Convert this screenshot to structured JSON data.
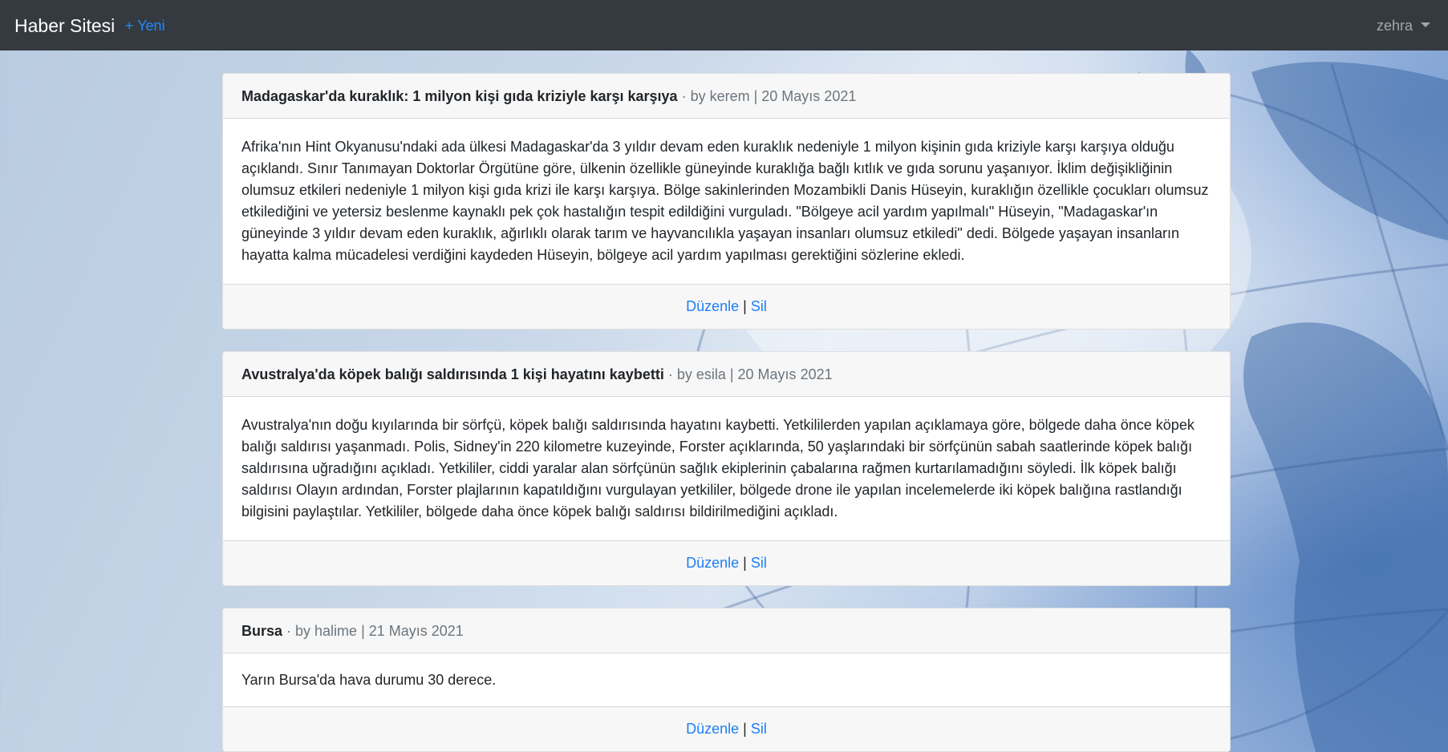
{
  "navbar": {
    "brand": "Haber Sitesi",
    "new_link": "+ Yeni",
    "user": "zehra"
  },
  "articles": [
    {
      "title": "Madagaskar'da kuraklık: 1 milyon kişi gıda kriziyle karşı karşıya",
      "meta": " · by kerem | 20 Mayıs 2021",
      "body": "Afrika'nın Hint Okyanusu'ndaki ada ülkesi Madagaskar'da 3 yıldır devam eden kuraklık nedeniyle 1 milyon kişinin gıda kriziyle karşı karşıya olduğu açıklandı. Sınır Tanımayan Doktorlar Örgütüne göre, ülkenin özellikle güneyinde kuraklığa bağlı kıtlık ve gıda sorunu yaşanıyor. İklim değişikliğinin olumsuz etkileri nedeniyle 1 milyon kişi gıda krizi ile karşı karşıya. Bölge sakinlerinden Mozambikli Danis Hüseyin, kuraklığın özellikle çocukları olumsuz etkilediğini ve yetersiz beslenme kaynaklı pek çok hastalığın tespit edildiğini vurguladı. \"Bölgeye acil yardım yapılmalı\" Hüseyin, \"Madagaskar'ın güneyinde 3 yıldır devam eden kuraklık, ağırlıklı olarak tarım ve hayvancılıkla yaşayan insanları olumsuz etkiledi\" dedi. Bölgede yaşayan insanların hayatta kalma mücadelesi verdiğini kaydeden Hüseyin, bölgeye acil yardım yapılması gerektiğini sözlerine ekledi.",
      "edit_label": "Düzenle",
      "separator": " | ",
      "delete_label": "Sil"
    },
    {
      "title": "Avustralya'da köpek balığı saldırısında 1 kişi hayatını kaybetti",
      "meta": " · by esila | 20 Mayıs 2021",
      "body": "Avustralya'nın doğu kıyılarında bir sörfçü, köpek balığı saldırısında hayatını kaybetti. Yetkililerden yapılan açıklamaya göre, bölgede daha önce köpek balığı saldırısı yaşanmadı. Polis, Sidney'in 220 kilometre kuzeyinde, Forster açıklarında, 50 yaşlarındaki bir sörfçünün sabah saatlerinde köpek balığı saldırısına uğradığını açıkladı. Yetkililer, ciddi yaralar alan sörfçünün sağlık ekiplerinin çabalarına rağmen kurtarılamadığını söyledi. İlk köpek balığı saldırısı Olayın ardından, Forster plajlarının kapatıldığını vurgulayan yetkililer, bölgede drone ile yapılan incelemelerde iki köpek balığına rastlandığı bilgisini paylaştılar. Yetkililer, bölgede daha önce köpek balığı saldırısı bildirilmediğini açıkladı.",
      "edit_label": "Düzenle",
      "separator": " | ",
      "delete_label": "Sil"
    },
    {
      "title": "Bursa",
      "meta": " · by halime | 21 Mayıs 2021",
      "body": "Yarın Bursa'da hava durumu 30 derece.",
      "edit_label": "Düzenle",
      "separator": " | ",
      "delete_label": "Sil"
    }
  ]
}
